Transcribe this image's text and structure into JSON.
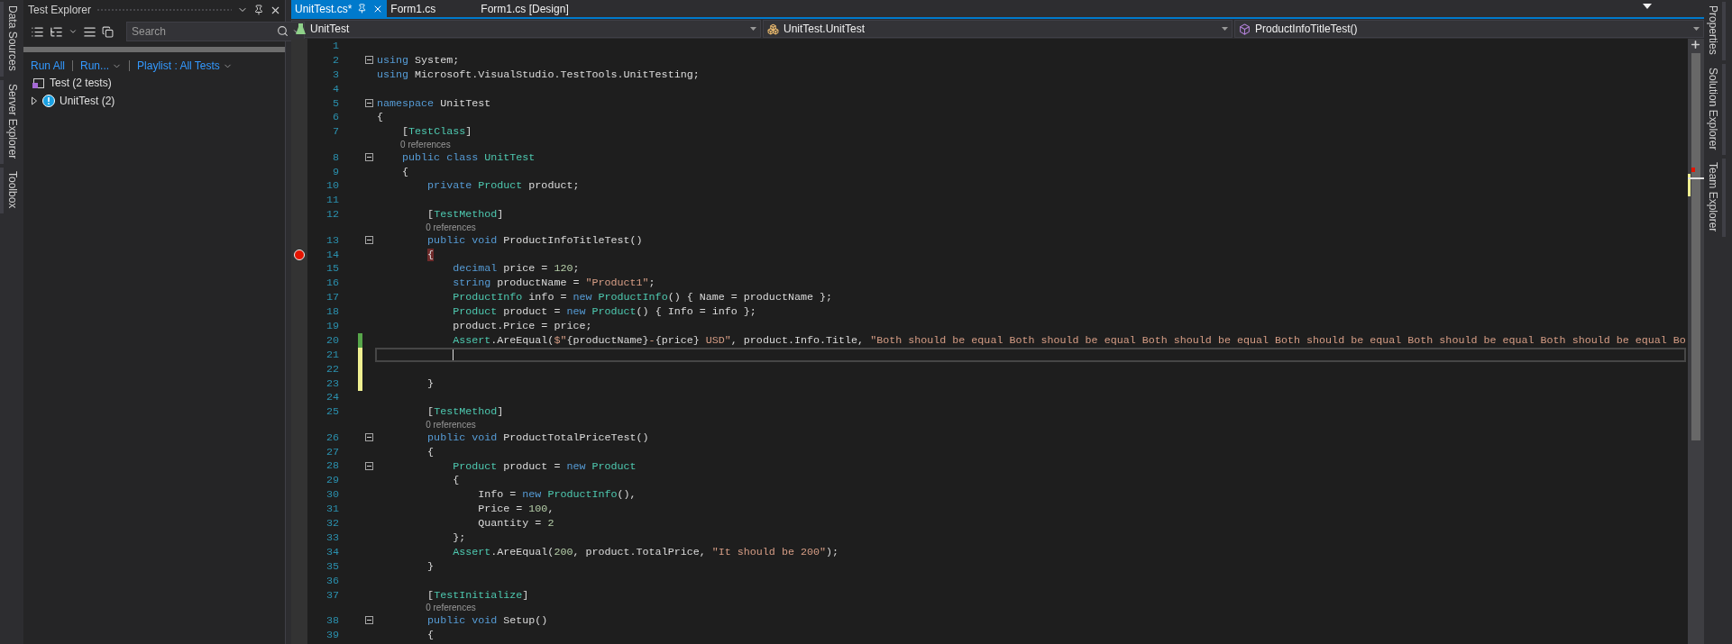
{
  "left_dock_tabs": [
    "Data Sources",
    "Server Explorer",
    "Toolbox"
  ],
  "test_explorer": {
    "title": "Test Explorer",
    "search": {
      "placeholder": "Search"
    },
    "commands": [
      {
        "label": "Run All"
      },
      {
        "label": "Run...",
        "dropdown": true
      },
      {
        "label": "Playlist : All Tests",
        "dropdown": true
      }
    ],
    "project": "Test (2 tests)",
    "tree": [
      {
        "label": "UnitTest (2)",
        "expanded": false
      }
    ]
  },
  "editor": {
    "tabs": [
      {
        "label": "UnitTest.cs*",
        "selected": true
      },
      {
        "label": "Form1.cs",
        "selected": false
      },
      {
        "label": "Form1.cs [Design]",
        "selected": false
      }
    ],
    "navigation": [
      {
        "kind": "project",
        "label": "UnitTest"
      },
      {
        "kind": "class",
        "label": "UnitTest.UnitTest"
      },
      {
        "kind": "method",
        "label": "ProductInfoTitleTest()"
      }
    ],
    "lines": [
      {
        "kind": "code",
        "number": "1"
      },
      {
        "kind": "code",
        "number": "2",
        "fold": true,
        "tokens": [
          {
            "kind": "kw",
            "text": "using"
          },
          {
            "kind": "plain",
            "text": " System;"
          }
        ]
      },
      {
        "kind": "code",
        "number": "3",
        "tokens": [
          {
            "kind": "kw",
            "text": "using"
          },
          {
            "kind": "plain",
            "text": " Microsoft.VisualStudio.TestTools.UnitTesting;"
          }
        ]
      },
      {
        "kind": "code",
        "number": "4"
      },
      {
        "kind": "code",
        "number": "5",
        "fold": true,
        "tokens": [
          {
            "kind": "kw",
            "text": "namespace"
          },
          {
            "kind": "plain",
            "text": " UnitTest"
          }
        ]
      },
      {
        "kind": "code",
        "number": "6",
        "tokens": [
          {
            "kind": "plain",
            "text": "{"
          }
        ]
      },
      {
        "kind": "code",
        "number": "7",
        "tokens": [
          {
            "kind": "plain",
            "text": "    ["
          },
          {
            "kind": "type",
            "text": "TestClass"
          },
          {
            "kind": "plain",
            "text": "]"
          }
        ]
      },
      {
        "kind": "references",
        "text": "0 references"
      },
      {
        "kind": "code",
        "number": "8",
        "fold": true,
        "tokens": [
          {
            "kind": "kw",
            "text": "    public class "
          },
          {
            "kind": "type",
            "text": "UnitTest"
          }
        ]
      },
      {
        "kind": "code",
        "number": "9",
        "tokens": [
          {
            "kind": "plain",
            "text": "    {"
          }
        ]
      },
      {
        "kind": "code",
        "number": "10",
        "tokens": [
          {
            "kind": "kw",
            "text": "        private "
          },
          {
            "kind": "type",
            "text": "Product"
          },
          {
            "kind": "plain",
            "text": " product;"
          }
        ]
      },
      {
        "kind": "code",
        "number": "11"
      },
      {
        "kind": "code",
        "number": "12",
        "tokens": [
          {
            "kind": "plain",
            "text": "        ["
          },
          {
            "kind": "type",
            "text": "TestMethod"
          },
          {
            "kind": "plain",
            "text": "]"
          }
        ]
      },
      {
        "kind": "references",
        "text": "0 references"
      },
      {
        "kind": "code",
        "number": "13",
        "fold": true,
        "tokens": [
          {
            "kind": "kw",
            "text": "        public void"
          },
          {
            "kind": "plain",
            "text": " ProductInfoTitleTest()"
          }
        ]
      },
      {
        "kind": "code",
        "number": "14",
        "breakpoint": true,
        "tokens": [
          {
            "kind": "brace",
            "text": "        {"
          }
        ]
      },
      {
        "kind": "code",
        "number": "15",
        "tokens": [
          {
            "kind": "kw",
            "text": "            decimal"
          },
          {
            "kind": "plain",
            "text": " price = "
          },
          {
            "kind": "num",
            "text": "120"
          },
          {
            "kind": "plain",
            "text": ";"
          }
        ]
      },
      {
        "kind": "code",
        "number": "16",
        "tokens": [
          {
            "kind": "kw",
            "text": "            string"
          },
          {
            "kind": "plain",
            "text": " productName = "
          },
          {
            "kind": "str",
            "text": "\"Product1\""
          },
          {
            "kind": "plain",
            "text": ";"
          }
        ]
      },
      {
        "kind": "code",
        "number": "17",
        "tokens": [
          {
            "kind": "type",
            "text": "            ProductInfo"
          },
          {
            "kind": "plain",
            "text": " info = "
          },
          {
            "kind": "kw",
            "text": "new "
          },
          {
            "kind": "type",
            "text": "ProductInfo"
          },
          {
            "kind": "plain",
            "text": "() { Name = productName };"
          }
        ]
      },
      {
        "kind": "code",
        "number": "18",
        "tokens": [
          {
            "kind": "type",
            "text": "            Product"
          },
          {
            "kind": "plain",
            "text": " product = "
          },
          {
            "kind": "kw",
            "text": "new "
          },
          {
            "kind": "type",
            "text": "Product"
          },
          {
            "kind": "plain",
            "text": "() { Info = info };"
          }
        ]
      },
      {
        "kind": "code",
        "number": "19",
        "tokens": [
          {
            "kind": "plain",
            "text": "            product.Price = price;"
          }
        ]
      },
      {
        "kind": "code",
        "number": "20",
        "saved": true,
        "tokens": [
          {
            "kind": "type",
            "text": "            Assert"
          },
          {
            "kind": "plain",
            "text": ".AreEqual("
          },
          {
            "kind": "str",
            "text": "$\""
          },
          {
            "kind": "plain",
            "text": "{productName}"
          },
          {
            "kind": "str",
            "text": "-"
          },
          {
            "kind": "plain",
            "text": "{price}"
          },
          {
            "kind": "str",
            "text": " USD\""
          },
          {
            "kind": "plain",
            "text": ", product.Info.Title, "
          },
          {
            "kind": "str",
            "text": "\"Both should be equal Both should be equal Both should be equal Both should be equal Both should be equal Both should be equal Bo"
          }
        ]
      },
      {
        "kind": "code",
        "number": "21",
        "saved": false,
        "current": true
      },
      {
        "kind": "code",
        "number": "22",
        "saved": false
      },
      {
        "kind": "code",
        "number": "23",
        "saved": false,
        "tokens": [
          {
            "kind": "plain",
            "text": "        }"
          }
        ]
      },
      {
        "kind": "code",
        "number": "24"
      },
      {
        "kind": "code",
        "number": "25",
        "tokens": [
          {
            "kind": "plain",
            "text": "        ["
          },
          {
            "kind": "type",
            "text": "TestMethod"
          },
          {
            "kind": "plain",
            "text": "]"
          }
        ]
      },
      {
        "kind": "references",
        "text": "0 references"
      },
      {
        "kind": "code",
        "number": "26",
        "fold": true,
        "tokens": [
          {
            "kind": "kw",
            "text": "        public void"
          },
          {
            "kind": "plain",
            "text": " ProductTotalPriceTest()"
          }
        ]
      },
      {
        "kind": "code",
        "number": "27",
        "tokens": [
          {
            "kind": "plain",
            "text": "        {"
          }
        ]
      },
      {
        "kind": "code",
        "number": "28",
        "fold": true,
        "tokens": [
          {
            "kind": "type",
            "text": "            Product"
          },
          {
            "kind": "plain",
            "text": " product = "
          },
          {
            "kind": "kw",
            "text": "new "
          },
          {
            "kind": "type",
            "text": "Product"
          }
        ]
      },
      {
        "kind": "code",
        "number": "29",
        "tokens": [
          {
            "kind": "plain",
            "text": "            {"
          }
        ]
      },
      {
        "kind": "code",
        "number": "30",
        "tokens": [
          {
            "kind": "plain",
            "text": "                Info = "
          },
          {
            "kind": "kw",
            "text": "new "
          },
          {
            "kind": "type",
            "text": "ProductInfo"
          },
          {
            "kind": "plain",
            "text": "(),"
          }
        ]
      },
      {
        "kind": "code",
        "number": "31",
        "tokens": [
          {
            "kind": "plain",
            "text": "                Price = "
          },
          {
            "kind": "num",
            "text": "100"
          },
          {
            "kind": "plain",
            "text": ","
          }
        ]
      },
      {
        "kind": "code",
        "number": "32",
        "tokens": [
          {
            "kind": "plain",
            "text": "                Quantity = "
          },
          {
            "kind": "num",
            "text": "2"
          }
        ]
      },
      {
        "kind": "code",
        "number": "33",
        "tokens": [
          {
            "kind": "plain",
            "text": "            };"
          }
        ]
      },
      {
        "kind": "code",
        "number": "34",
        "tokens": [
          {
            "kind": "type",
            "text": "            Assert"
          },
          {
            "kind": "plain",
            "text": ".AreEqual("
          },
          {
            "kind": "num",
            "text": "200"
          },
          {
            "kind": "plain",
            "text": ", product.TotalPrice, "
          },
          {
            "kind": "str",
            "text": "\"It should be 200\""
          },
          {
            "kind": "plain",
            "text": ");"
          }
        ]
      },
      {
        "kind": "code",
        "number": "35",
        "tokens": [
          {
            "kind": "plain",
            "text": "        }"
          }
        ]
      },
      {
        "kind": "code",
        "number": "36"
      },
      {
        "kind": "code",
        "number": "37",
        "tokens": [
          {
            "kind": "plain",
            "text": "        ["
          },
          {
            "kind": "type",
            "text": "TestInitialize"
          },
          {
            "kind": "plain",
            "text": "]"
          }
        ]
      },
      {
        "kind": "references",
        "text": "0 references"
      },
      {
        "kind": "code",
        "number": "38",
        "fold": true,
        "tokens": [
          {
            "kind": "kw",
            "text": "        public void"
          },
          {
            "kind": "plain",
            "text": " Setup()"
          }
        ]
      },
      {
        "kind": "code",
        "number": "39",
        "tokens": [
          {
            "kind": "plain",
            "text": "        {"
          }
        ]
      }
    ]
  },
  "right_dock_tabs": [
    "Properties",
    "Solution Explorer",
    "Team Explorer"
  ]
}
